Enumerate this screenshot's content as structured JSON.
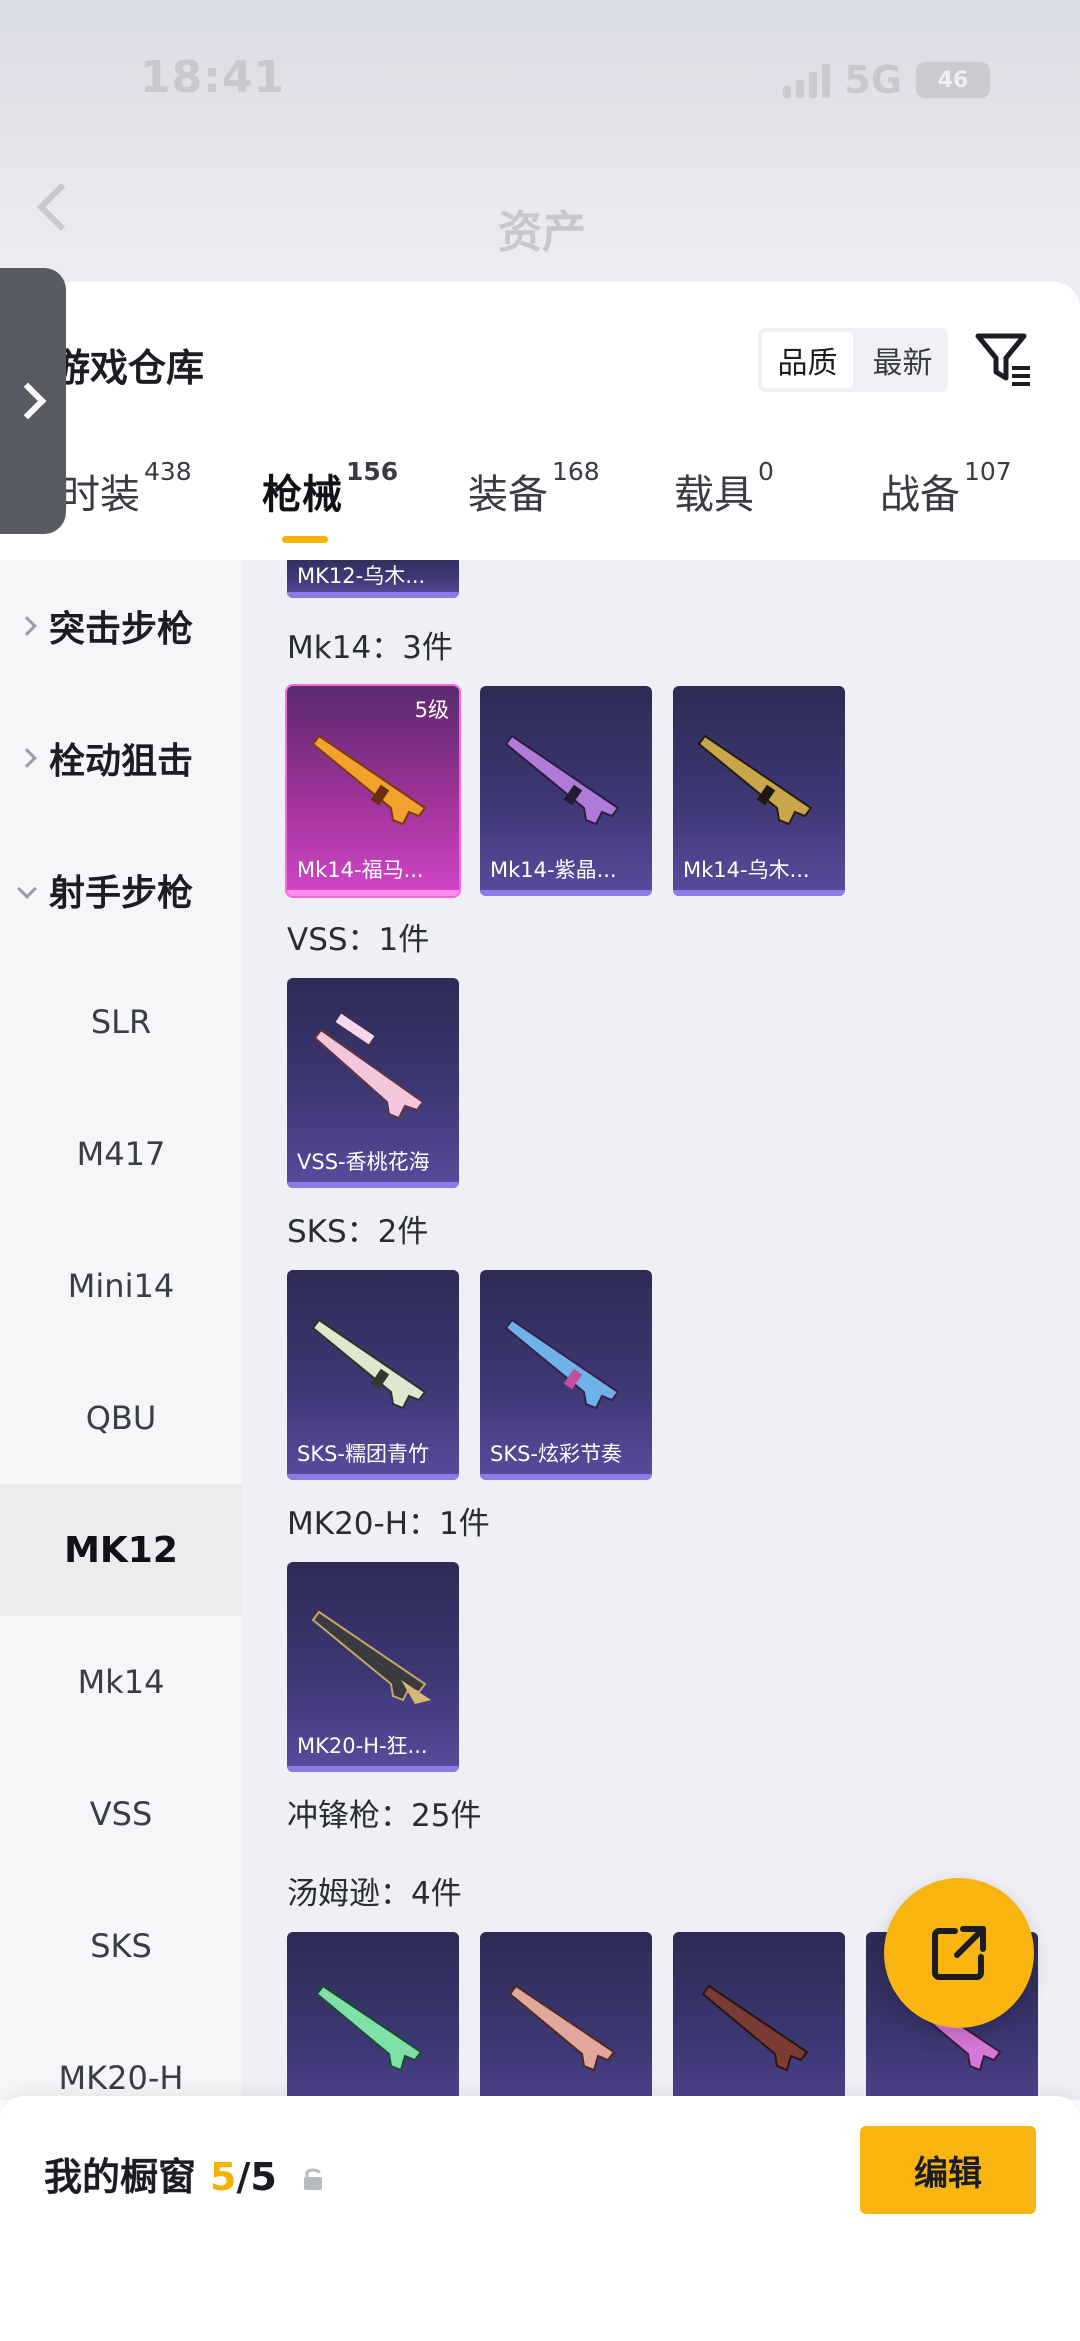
{
  "status_bar": {
    "time": "18:41",
    "network": "5G",
    "battery": "46"
  },
  "nav": {
    "title": "资产"
  },
  "warehouse": {
    "title": "游戏仓库",
    "sort_options": [
      "品质",
      "最新"
    ],
    "sort_active": "品质"
  },
  "tabs": [
    {
      "label": "时装",
      "count": "438"
    },
    {
      "label": "枪械",
      "count": "156"
    },
    {
      "label": "装备",
      "count": "168"
    },
    {
      "label": "载具",
      "count": "0"
    },
    {
      "label": "战备",
      "count": "107"
    }
  ],
  "active_tab": "枪械",
  "left_nav": {
    "categories": [
      {
        "label": "突击步枪",
        "expanded": false
      },
      {
        "label": "栓动狙击",
        "expanded": false
      },
      {
        "label": "射手步枪",
        "expanded": true
      }
    ],
    "subitems": [
      "SLR",
      "M417",
      "Mini14",
      "QBU",
      "MK12",
      "Mk14",
      "VSS",
      "SKS",
      "MK20-H"
    ],
    "selected": "MK12"
  },
  "content": {
    "top_cut_item": "MK12-乌木...",
    "groups": [
      {
        "label": "Mk14：3件",
        "items": [
          {
            "name": "Mk14-福马...",
            "level": "5级",
            "rarity": "legend"
          },
          {
            "name": "Mk14-紫晶...",
            "level": "",
            "rarity": "epic"
          },
          {
            "name": "Mk14-乌木...",
            "level": "",
            "rarity": "epic"
          }
        ]
      },
      {
        "label": "VSS：1件",
        "items": [
          {
            "name": "VSS-香桃花海",
            "level": "",
            "rarity": "epic"
          }
        ]
      },
      {
        "label": "SKS：2件",
        "items": [
          {
            "name": "SKS-糯团青竹",
            "level": "",
            "rarity": "epic"
          },
          {
            "name": "SKS-炫彩节奏",
            "level": "",
            "rarity": "epic"
          }
        ]
      },
      {
        "label": "MK20-H：1件",
        "items": [
          {
            "name": "MK20-H-狂...",
            "level": "",
            "rarity": "epic"
          }
        ]
      }
    ],
    "smg_label": "冲锋枪：25件",
    "thompson_label": "汤姆逊：4件"
  },
  "bottom": {
    "showcase_label": "我的橱窗",
    "showcase_used": "5",
    "showcase_total": "/5",
    "edit_label": "编辑"
  },
  "colors": {
    "accent": "#f8b50f",
    "epic_tile": "#3d3874",
    "legend_tile": "#a0339a"
  },
  "icons": [
    "back-icon",
    "filter-icon",
    "share-icon",
    "lock-icon",
    "drawer-chevron-icon"
  ]
}
